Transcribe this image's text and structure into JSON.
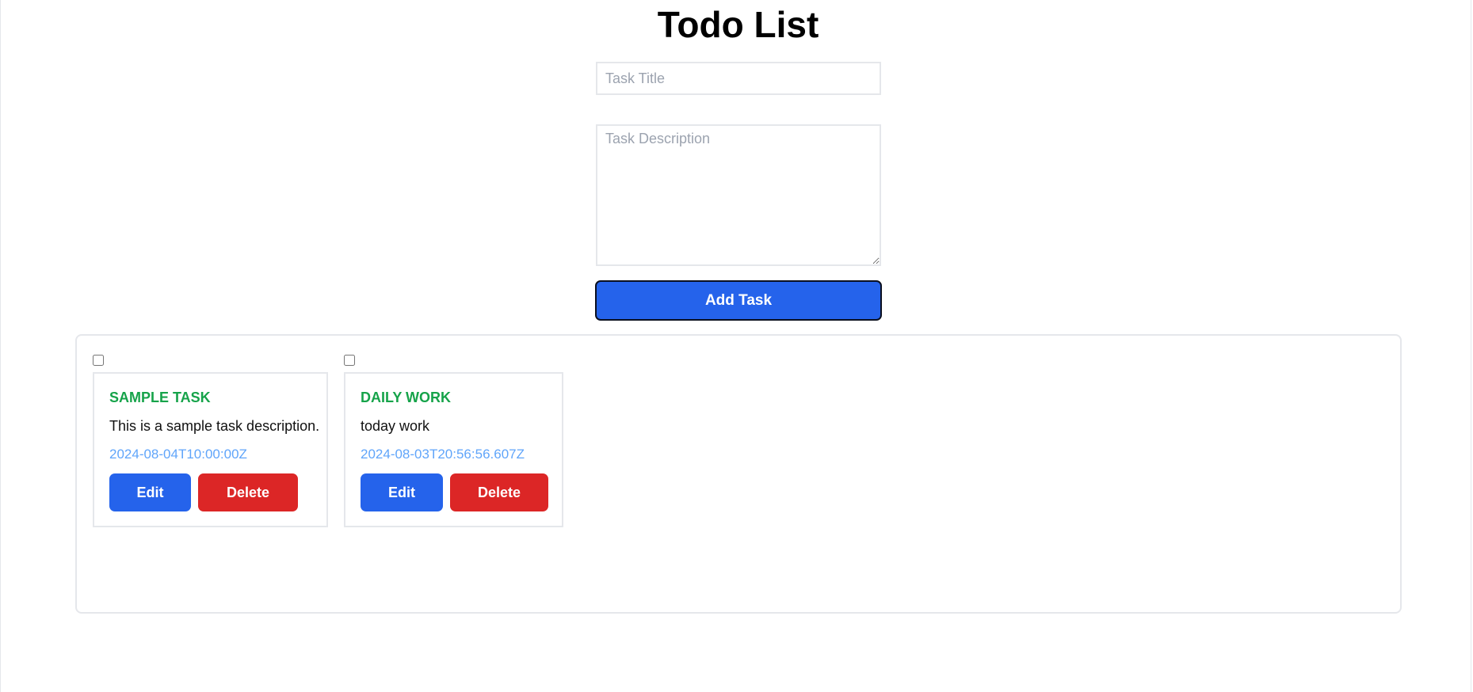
{
  "page": {
    "title": "Todo List"
  },
  "form": {
    "title_placeholder": "Task Title",
    "title_value": "",
    "description_placeholder": "Task Description",
    "description_value": "",
    "add_label": "Add Task"
  },
  "tasks": [
    {
      "title": "SAMPLE TASK",
      "description": "This is a sample task description.",
      "date": "2024-08-04T10:00:00Z",
      "checked": false,
      "edit_label": "Edit",
      "delete_label": "Delete"
    },
    {
      "title": "DAILY WORK",
      "description": "today work",
      "date": "2024-08-03T20:56:56.607Z",
      "checked": false,
      "edit_label": "Edit",
      "delete_label": "Delete"
    }
  ],
  "colors": {
    "primary": "#2563eb",
    "danger": "#dc2626",
    "task_title": "#16a34a",
    "task_date": "#60a5fa"
  }
}
